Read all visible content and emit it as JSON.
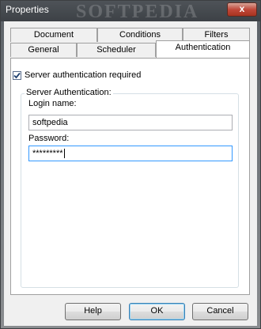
{
  "window": {
    "title": "Properties",
    "close_label": "x"
  },
  "watermark": "SOFTPEDIA",
  "tabs": {
    "back_row": [
      "Document",
      "Conditions",
      "Filters"
    ],
    "front_row": [
      "General",
      "Scheduler",
      "Authentication"
    ],
    "active": "Authentication"
  },
  "auth": {
    "checkbox_label": "Server authentication required",
    "checked": true,
    "group_title": "Server Authentication:",
    "login_label": "Login name:",
    "login_value": "softpedia",
    "password_label": "Password:",
    "password_value": "*********"
  },
  "buttons": {
    "help": "Help",
    "ok": "OK",
    "cancel": "Cancel"
  }
}
